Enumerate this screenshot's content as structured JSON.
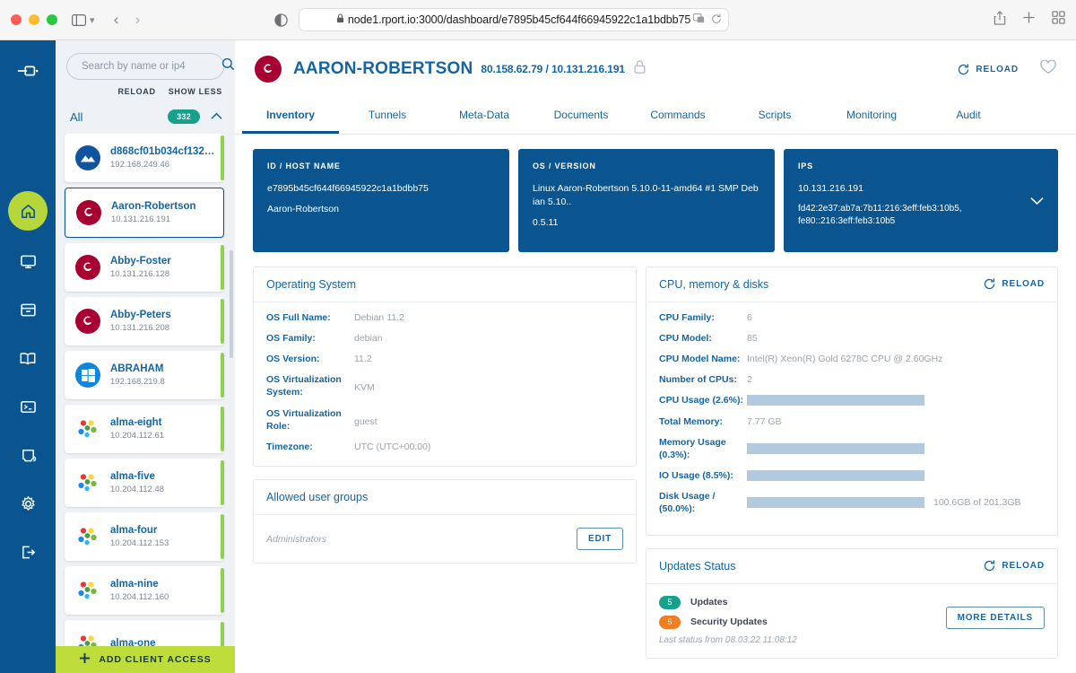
{
  "browser": {
    "url": "node1.rport.io:3000/dashboard/e7895b45cf644f66945922c1a1bdbb75",
    "lock_icon": "lock-icon",
    "back_label": "‹",
    "forward_label": "›"
  },
  "rail": {
    "items": [
      {
        "name": "logo-icon",
        "label": "rport-logo"
      },
      {
        "name": "home-icon",
        "label": "Home"
      },
      {
        "name": "monitor-icon",
        "label": "Clients"
      },
      {
        "name": "archive-icon",
        "label": "Vault"
      },
      {
        "name": "book-icon",
        "label": "Library"
      },
      {
        "name": "terminal-icon",
        "label": "Commands"
      },
      {
        "name": "script-icon",
        "label": "Scripts"
      },
      {
        "name": "gear-icon",
        "label": "Settings"
      },
      {
        "name": "logout-icon",
        "label": "Logout"
      }
    ]
  },
  "sidebar": {
    "search": {
      "placeholder": "Search by name or ip4",
      "value": ""
    },
    "actions": {
      "reload": "RELOAD",
      "show_less": "SHOW LESS"
    },
    "group": {
      "label": "All",
      "count": "332"
    },
    "add_client": "ADD CLIENT ACCESS",
    "clients": [
      {
        "name": "d868cf01b034cf132f…",
        "ip": "192.168.249.46",
        "os": "rocky",
        "selected": false
      },
      {
        "name": "Aaron-Robertson",
        "ip": "10.131.216.191",
        "os": "debian",
        "selected": true
      },
      {
        "name": "Abby-Foster",
        "ip": "10.131.216.128",
        "os": "debian",
        "selected": false
      },
      {
        "name": "Abby-Peters",
        "ip": "10.131.216.208",
        "os": "debian",
        "selected": false
      },
      {
        "name": "ABRAHAM",
        "ip": "192.168.219.8",
        "os": "windows",
        "selected": false
      },
      {
        "name": "alma-eight",
        "ip": "10.204.112.61",
        "os": "alma",
        "selected": false
      },
      {
        "name": "alma-five",
        "ip": "10.204.112.48",
        "os": "alma",
        "selected": false
      },
      {
        "name": "alma-four",
        "ip": "10.204.112.153",
        "os": "alma",
        "selected": false
      },
      {
        "name": "alma-nine",
        "ip": "10.204.112.160",
        "os": "alma",
        "selected": false
      },
      {
        "name": "alma-one",
        "ip": "",
        "os": "alma",
        "selected": false
      }
    ]
  },
  "header": {
    "title": "AARON-ROBERTSON",
    "ips": "80.158.62.79 / 10.131.216.191",
    "reload": "RELOAD",
    "favorite_icon": "heart-icon",
    "lock_icon": "lock-icon"
  },
  "tabs": [
    {
      "label": "Inventory",
      "active": true
    },
    {
      "label": "Tunnels",
      "active": false
    },
    {
      "label": "Meta-Data",
      "active": false
    },
    {
      "label": "Documents",
      "active": false
    },
    {
      "label": "Commands",
      "active": false
    },
    {
      "label": "Scripts",
      "active": false
    },
    {
      "label": "Monitoring",
      "active": false
    },
    {
      "label": "Audit",
      "active": false
    }
  ],
  "summary": {
    "id_card": {
      "label": "ID / HOST NAME",
      "id": "e7895b45cf644f66945922c1a1bdbb75",
      "hostname": "Aaron-Robertson"
    },
    "os_card": {
      "label": "OS / VERSION",
      "kernel": "Linux Aaron-Robertson 5.10.0-11-amd64 #1 SMP Debian 5.10..",
      "version": "0.5.11"
    },
    "ips_card": {
      "label": "IPS",
      "ipv4": "10.131.216.191",
      "ipv6": "fd42:2e37:ab7a:7b11:216:3eff:feb3:10b5,\nfe80::216:3eff:feb3:10b5"
    }
  },
  "operating_system": {
    "title": "Operating System",
    "rows": [
      {
        "key": "OS Full Name:",
        "value": "Debian 11.2"
      },
      {
        "key": "OS Family:",
        "value": "debian"
      },
      {
        "key": "OS Version:",
        "value": "11.2"
      },
      {
        "key": "OS Virtualization System:",
        "value": "KVM"
      },
      {
        "key": "OS Virtualization Role:",
        "value": "guest"
      },
      {
        "key": "Timezone:",
        "value": "UTC (UTC+00:00)"
      }
    ]
  },
  "allowed_user_groups": {
    "title": "Allowed user groups",
    "group": "Administrators",
    "edit": "EDIT"
  },
  "cpu_memory_disks": {
    "title": "CPU, memory & disks",
    "reload": "RELOAD",
    "rows": [
      {
        "key": "CPU Family:",
        "value": "6"
      },
      {
        "key": "CPU Model:",
        "value": "85"
      },
      {
        "key": "CPU Model Name:",
        "value": "Intel(R) Xeon(R) Gold 6278C CPU @ 2.60GHz"
      },
      {
        "key": "Number of CPUs:",
        "value": "2"
      }
    ],
    "total_memory": {
      "key": "Total Memory:",
      "value": "7.77 GB"
    },
    "bars": [
      {
        "key": "CPU Usage (2.6%):",
        "percent": 2.6,
        "note": ""
      },
      {
        "key": "Memory Usage (0.3%):",
        "percent": 0.3,
        "note": ""
      },
      {
        "key": "IO Usage (8.5%):",
        "percent": 8.5,
        "note": ""
      },
      {
        "key": "Disk Usage / (50.0%):",
        "percent": 50.0,
        "note": "100.6GB of 201.3GB"
      }
    ]
  },
  "updates_status": {
    "title": "Updates Status",
    "reload": "RELOAD",
    "updates": {
      "count": "5",
      "label": "Updates",
      "color": "#17a08c"
    },
    "security_updates": {
      "count": "5",
      "label": "Security Updates",
      "color": "#ef7d22"
    },
    "last_status": "Last status from 08.03.22 11:08:12",
    "more_details": "MORE DETAILS"
  }
}
